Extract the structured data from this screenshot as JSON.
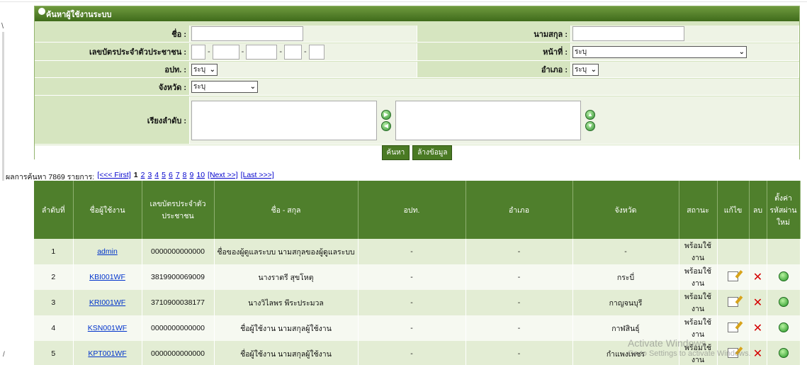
{
  "search": {
    "title": "ค้นหาผู้ใช้งานระบบ",
    "first_name_label": "ชื่อ :",
    "last_name_label": "นามสกุล :",
    "citizen_id_label": "เลขบัตรประจำตัวประชาชน :",
    "position_label": "หน้าที่ :",
    "position_value": "ระบุ",
    "org_label": "อปท. :",
    "org_value": "ระบุ",
    "district_label": "อำเภอ :",
    "district_value": "ระบุ",
    "province_label": "จังหวัด :",
    "province_value": "ระบุ",
    "sort_label": "เรียงลำดับ :",
    "search_button": "ค้นหา",
    "clear_button": "ล้างข้อมูล"
  },
  "pager": {
    "summary": "ผลการค้นหา 7869 รายการ:",
    "first": "[<<< First]",
    "current": "1",
    "p2": "2",
    "p3": "3",
    "p4": "4",
    "p5": "5",
    "p6": "6",
    "p7": "7",
    "p8": "8",
    "p9": "9",
    "p10": "10",
    "next": "[Next >>]",
    "last": "[Last >>>]"
  },
  "table": {
    "headers": {
      "no": "ลำดับที่",
      "username": "ชื่อผู้ใช้งาน",
      "citizen_id": "เลขบัตรประจำตัวประชาชน",
      "fullname": "ชื่อ - สกุล",
      "org": "อปท.",
      "district": "อำเภอ",
      "province": "จังหวัด",
      "status": "สถานะ",
      "edit": "แก้ไข",
      "delete": "ลบ",
      "reset": "ตั้งค่ารหัสผ่านใหม่"
    },
    "rows": [
      {
        "no": "1",
        "username": "admin",
        "citizen_id": "0000000000000",
        "fullname": "ชื่อของผู้ดูแลระบบ นามสกุลของผู้ดูแลระบบ",
        "org": "-",
        "district": "-",
        "province": "-",
        "status": "พร้อมใช้งาน"
      },
      {
        "no": "2",
        "username": "KBI001WF",
        "citizen_id": "3819900069009",
        "fullname": "นางราตรี สุขโหตุ",
        "org": "-",
        "district": "-",
        "province": "กระบี่",
        "status": "พร้อมใช้งาน"
      },
      {
        "no": "3",
        "username": "KRI001WF",
        "citizen_id": "3710900038177",
        "fullname": "นางวิไลพร พีระประมวล",
        "org": "-",
        "district": "-",
        "province": "กาญจนบุรี",
        "status": "พร้อมใช้งาน"
      },
      {
        "no": "4",
        "username": "KSN001WF",
        "citizen_id": "0000000000000",
        "fullname": "ชื่อผู้ใช้งาน นามสกุลผู้ใช้งาน",
        "org": "-",
        "district": "-",
        "province": "กาฬสินธุ์",
        "status": "พร้อมใช้งาน"
      },
      {
        "no": "5",
        "username": "KPT001WF",
        "citizen_id": "0000000000000",
        "fullname": "ชื่อผู้ใช้งาน นามสกุลผู้ใช้งาน",
        "org": "-",
        "district": "-",
        "province": "กำแพงเพชร",
        "status": "พร้อมใช้งาน"
      }
    ]
  },
  "watermark": {
    "line1": "Activate Windows",
    "line2": "Go to Settings to activate Windows."
  },
  "colors": {
    "header_green": "#4f7f2c",
    "panel_green": "#d6e5c0",
    "row_odd": "#e3edd4",
    "row_even": "#f6f9f1",
    "delete_red": "#d40000"
  }
}
